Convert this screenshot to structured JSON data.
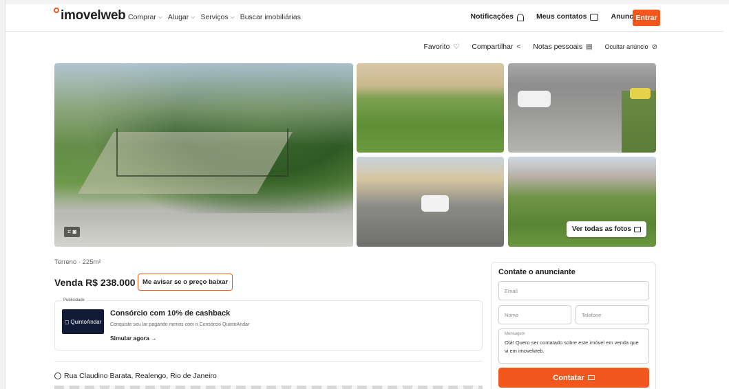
{
  "header": {
    "logo": "imovelweb",
    "nav": [
      "Comprar",
      "Alugar",
      "Serviços",
      "Buscar imobiliárias"
    ],
    "notificacoes": "Notificações",
    "meus_contatos": "Meus contatos",
    "anunciar": "Anunciar",
    "entrar": "Entrar"
  },
  "actions": {
    "favorito": "Favorito",
    "compartilhar": "Compartilhar",
    "notas": "Notas pessoais",
    "ocultar": "Ocultar anúncio"
  },
  "gallery": {
    "ver_todas": "Ver todas as fotos"
  },
  "listing": {
    "meta": "Terreno · 225m²",
    "price": "Venda R$ 238.000",
    "price_alert": "Me avisar se o preço baixar",
    "address": "Rua Claudino Barata, Realengo, Rio de Janeiro"
  },
  "ad": {
    "tag": "Publicidade",
    "brand": "QuintoAndar",
    "title": "Consórcio com 10% de cashback",
    "subtitle": "Conquiste seu lar pagando menos com o Consórcio QuintoAndar",
    "link": "Simular agora"
  },
  "contact": {
    "title": "Contate o anunciante",
    "email_placeholder": "Email",
    "nome_placeholder": "Nome",
    "telefone_placeholder": "Telefone",
    "mensagem_label": "Mensagem",
    "mensagem_text": "Olá! Quero ser contatado sobre este imóvel em venda que vi em imovelweb.",
    "submit": "Contatar"
  },
  "colors": {
    "accent": "#f2571e"
  }
}
